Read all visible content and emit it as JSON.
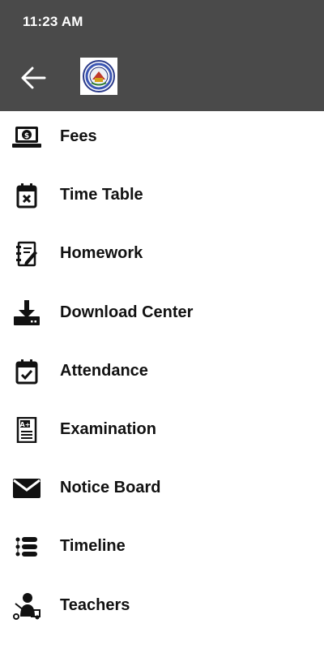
{
  "status_bar": {
    "time": "11:23 AM"
  },
  "app_bar": {
    "back_icon": "arrow-left-icon",
    "logo": "school-logo"
  },
  "menu": {
    "items": [
      {
        "label": "Fees",
        "icon": "fees-icon"
      },
      {
        "label": "Time Table",
        "icon": "calendar-x-icon"
      },
      {
        "label": "Homework",
        "icon": "homework-icon"
      },
      {
        "label": "Download Center",
        "icon": "download-icon"
      },
      {
        "label": "Attendance",
        "icon": "calendar-check-icon"
      },
      {
        "label": "Examination",
        "icon": "exam-grade-icon"
      },
      {
        "label": "Notice Board",
        "icon": "envelope-icon"
      },
      {
        "label": "Timeline",
        "icon": "timeline-list-icon"
      },
      {
        "label": "Teachers",
        "icon": "teacher-icon"
      }
    ]
  },
  "colors": {
    "bar_background": "#4a4a4a",
    "text": "#111111",
    "background": "#ffffff"
  }
}
